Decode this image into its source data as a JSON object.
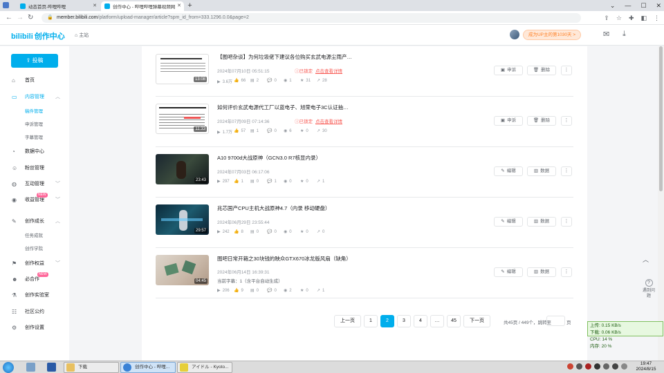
{
  "browser": {
    "tabs": [
      {
        "title": "动态首页-哔哩哔哩",
        "active": false,
        "icon": "bilibili-icon",
        "icon_color": "#00aeec"
      },
      {
        "title": "创作中心 - 哔哩哔哩弹幕视频网",
        "active": true,
        "icon": "bilibili-icon",
        "icon_color": "#00aeec"
      }
    ],
    "url_host": "member.bilibili.com",
    "url_path": "/platform/upload-manager/article?spm_id_from=333.1296.0.0&page=2"
  },
  "header": {
    "logo_main": "bilibili",
    "logo_sub": "创作中心",
    "home_label": "主站",
    "upgrade_label": "成为UP主的第1030天 >"
  },
  "sidebar": {
    "upload_label": "投稿",
    "items": [
      {
        "label": "首页",
        "icon": "home-icon",
        "active": false
      },
      {
        "label": "内容管理",
        "icon": "content-icon",
        "active": true,
        "expand": "up"
      },
      {
        "label": "稿件管理",
        "sub": true,
        "active": true
      },
      {
        "label": "申诉管理",
        "sub": true,
        "active": false
      },
      {
        "label": "字幕管理",
        "sub": true,
        "active": false
      },
      {
        "label": "数据中心",
        "icon": "data-icon",
        "active": false
      },
      {
        "label": "粉丝管理",
        "icon": "fans-icon",
        "active": false
      },
      {
        "label": "互动管理",
        "icon": "interact-icon",
        "active": false,
        "expand": "down"
      },
      {
        "label": "收益管理",
        "icon": "income-icon",
        "active": false,
        "expand": "down",
        "badge": "NEW"
      },
      {
        "label": "创作成长",
        "icon": "growth-icon",
        "active": false,
        "expand": "up"
      },
      {
        "label": "任务成就",
        "sub": true,
        "active": false
      },
      {
        "label": "创作学院",
        "sub": true,
        "active": false
      },
      {
        "label": "创作权益",
        "icon": "rights-icon",
        "active": false,
        "expand": "down"
      },
      {
        "label": "必合作",
        "icon": "collab-icon",
        "active": false,
        "badge": "NEW"
      },
      {
        "label": "创作实验室",
        "icon": "lab-icon",
        "active": false
      },
      {
        "label": "社区公约",
        "icon": "rules-icon",
        "active": false
      },
      {
        "label": "创作设置",
        "icon": "settings-icon",
        "active": false
      }
    ]
  },
  "videos": [
    {
      "title": "【图吧杂谈】为何垃圾佬下建议各位购买玄武电源尘雨产…",
      "date": "2024年07月10日 05:51:15",
      "locked": "已锁定",
      "locked_more": "点击查看详情",
      "duration": "13:08",
      "stats": [
        "3.6万",
        "66",
        "2",
        "0",
        "1",
        "31",
        "28"
      ],
      "actions": [
        "申诉",
        "删除"
      ],
      "thumb": "text-doc"
    },
    {
      "title": "如何评价玄武电源代工厂以蓝电子、旭荣电子3C认证抽…",
      "date": "2024年07月09日 07:14:36",
      "locked": "已锁定",
      "locked_more": "点击查看详情",
      "duration": "11:33",
      "stats": [
        "1.7万",
        "57",
        "1",
        "0",
        "6",
        "0",
        "30"
      ],
      "actions": [
        "申诉",
        "删除"
      ],
      "thumb": "text-doc2"
    },
    {
      "title": "A10 9700d大战原神（GCN3.0 R7核显内录）",
      "date": "2024年07月03日 06:17:06",
      "duration": "23:43",
      "stats": [
        "297",
        "1",
        "0",
        "1",
        "0",
        "0",
        "1"
      ],
      "actions": [
        "编辑",
        "数据"
      ],
      "thumb": "game-dark"
    },
    {
      "title": "兆芯国产CPU主机大战原神4.7（内录 移动硬盘）",
      "date": "2024年06月29日 23:55:44",
      "duration": "29:57",
      "stats": [
        "242",
        "8",
        "0",
        "0",
        "0",
        "0",
        "0"
      ],
      "actions": [
        "编辑",
        "数据"
      ],
      "thumb": "game-blue"
    },
    {
      "title": "图吧日常开箱之30块钱的映众GTX670冰龙版风扇（缺角）",
      "date": "2024年06月14日 16:39:31",
      "note": "当前字幕：1（含平台自动生成）",
      "duration": "04:45",
      "stats": [
        "206",
        "9",
        "0",
        "0",
        "2",
        "0",
        "1"
      ],
      "actions": [
        "编辑",
        "数据"
      ],
      "thumb": "hands"
    }
  ],
  "pagination": {
    "prev": "上一页",
    "pages": [
      "1",
      "2",
      "3",
      "4",
      "…",
      "45"
    ],
    "current": "2",
    "next": "下一页",
    "total": "共45页 / 449个，跳转至",
    "page_suffix": "页"
  },
  "float": {
    "feedback": "遇到问题"
  },
  "netmeter": {
    "up": "上传: 0.15 KB/s",
    "down": "下载: 0.06 KB/s",
    "cpu": "CPU: 14 %",
    "mem": "内存: 20 %"
  },
  "taskbar": {
    "items": [
      {
        "label": "下载",
        "active": false,
        "color": "#e8c060"
      },
      {
        "label": "创作中心 - 哔哩...",
        "active": true,
        "color": "#3a82d6"
      },
      {
        "label": "アイドル - Kyoto...",
        "active": false,
        "color": "#e6cf3a"
      }
    ],
    "time": "19:47",
    "date": "2024/8/15"
  },
  "colors": {
    "accent": "#00aeec",
    "locked": "#f85a54",
    "badge": "#ff6699"
  }
}
